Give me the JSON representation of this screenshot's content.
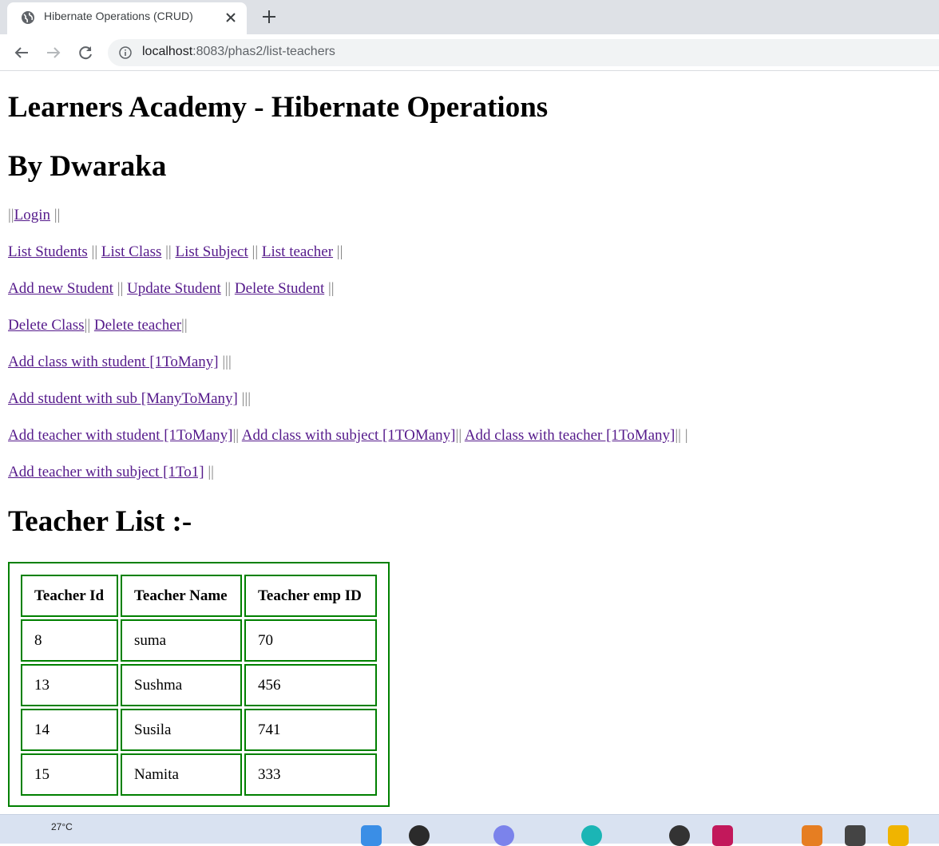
{
  "browser": {
    "tab_title": "Hibernate Operations (CRUD)",
    "url_host": "localhost",
    "url_rest": ":8083/phas2/list-teachers"
  },
  "page": {
    "title": "Learners Academy - Hibernate Operations",
    "author": "By Dwaraka",
    "login": {
      "prefix": "||",
      "link": "Login",
      "suffix": " ||"
    },
    "nav_lines": [
      {
        "items": [
          {
            "link": "List Students",
            "after": " || "
          },
          {
            "link": "List Class",
            "after": " || "
          },
          {
            "link": "List Subject",
            "after": " || "
          },
          {
            "link": "List teacher",
            "after": " ||"
          }
        ]
      },
      {
        "items": [
          {
            "link": "Add new Student",
            "after": " || "
          },
          {
            "link": "Update Student",
            "after": " || "
          },
          {
            "link": "Delete Student",
            "after": " ||"
          }
        ]
      },
      {
        "items": [
          {
            "link": "Delete Class",
            "after": "|| "
          },
          {
            "link": "Delete teacher",
            "after": "||"
          }
        ]
      },
      {
        "items": [
          {
            "link": "Add class with student [1ToMany]",
            "after": " |||"
          }
        ]
      },
      {
        "items": [
          {
            "link": "Add student with sub [ManyToMany]",
            "after": " |||"
          }
        ]
      },
      {
        "items": [
          {
            "link": "Add teacher with student [1ToMany]",
            "after": "|| "
          },
          {
            "link": "Add class with subject [1TOMany]",
            "after": "|| "
          },
          {
            "link": "Add class with teacher [1ToMany]",
            "after": "|| |"
          }
        ]
      },
      {
        "items": [
          {
            "link": "Add teacher with subject [1To1]",
            "after": " ||"
          }
        ]
      }
    ],
    "list_heading": "Teacher List :-",
    "table": {
      "headers": [
        "Teacher Id",
        "Teacher Name",
        "Teacher emp ID"
      ],
      "rows": [
        [
          "8",
          "suma",
          "70"
        ],
        [
          "13",
          "Sushma",
          "456"
        ],
        [
          "14",
          "Susila",
          "741"
        ],
        [
          "15",
          "Namita",
          "333"
        ]
      ]
    }
  },
  "taskbar": {
    "weather": "27°C"
  },
  "colors": {
    "link": "#551a8b",
    "table_border": "#008000",
    "separator": "#808080"
  }
}
